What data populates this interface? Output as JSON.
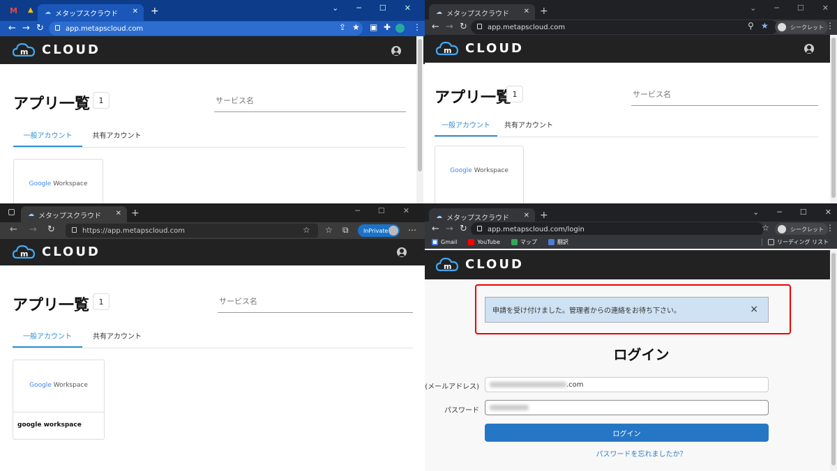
{
  "windows": {
    "w1": {
      "tab_title": "メタップスクラウド",
      "url": "app.metapscloud.com"
    },
    "w2": {
      "tab_title": "メタップスクラウド",
      "url": "app.metapscloud.com",
      "mode_label": "シークレット"
    },
    "w3": {
      "tab_title": "メタップスクラウド",
      "url": "https://app.metapscloud.com",
      "mode_label": "InPrivate"
    },
    "w4": {
      "tab_title": "メタップスクラウド",
      "url": "app.metapscloud.com/login",
      "mode_label": "シークレット",
      "bookmarks": [
        "Gmail",
        "YouTube",
        "マップ",
        "翻訳"
      ],
      "reading_list": "リーディング リスト"
    }
  },
  "site": {
    "logo_text": "CLOUD",
    "logo_mark": "m"
  },
  "apps_page": {
    "title": "アプリ一覧",
    "count": "1",
    "search_placeholder": "サービス名",
    "tab_general": "一般アカウント",
    "tab_shared": "共有アカウント",
    "card_logo_google": "Google",
    "card_logo_workspace": " Workspace",
    "card_label": "google workspace"
  },
  "login_page": {
    "flash_message": "申請を受け付けました。管理者からの連絡をお待ち下さい。",
    "close_glyph": "×",
    "heading": "ログイン",
    "email_label": "(メールアドレス)",
    "email_suffix": ".com",
    "password_label": "パスワード",
    "login_button": "ログイン",
    "forgot_link": "パスワードを忘れましたか？"
  },
  "colors": {
    "chrome_blue": "#0d3d8a",
    "chrome_dark": "#202124",
    "accent": "#2e8fd3",
    "login_button": "#2577c5",
    "highlight_box": "#e00000"
  }
}
